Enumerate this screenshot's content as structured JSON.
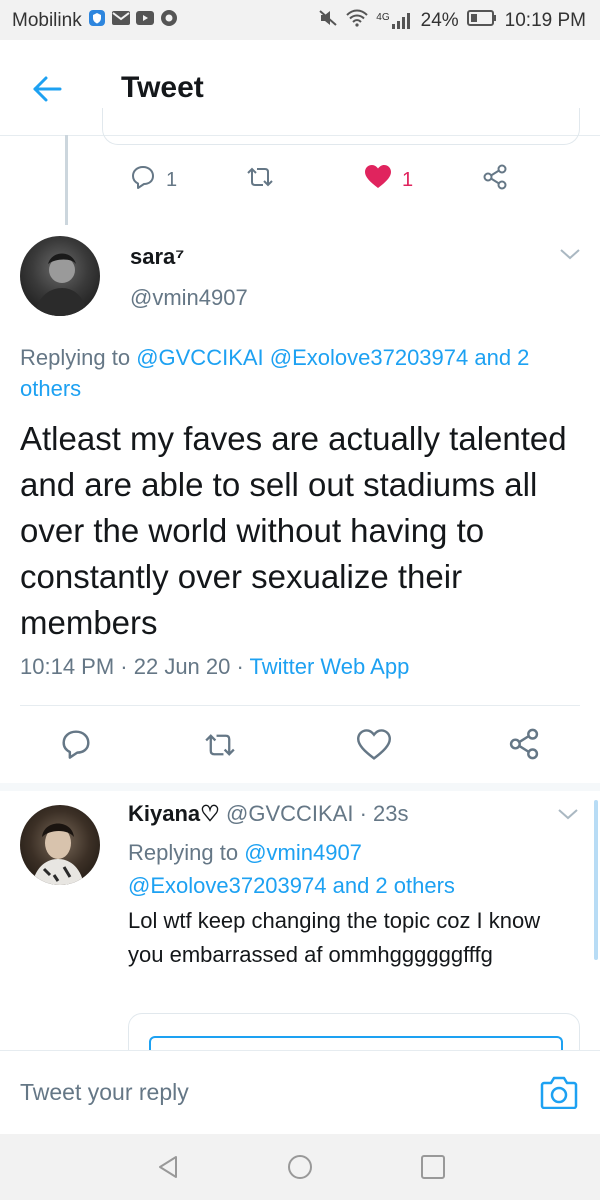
{
  "status_bar": {
    "carrier": "Mobilink",
    "network": "4G",
    "battery": "24%",
    "time": "10:19 PM"
  },
  "app_bar": {
    "title": "Tweet"
  },
  "parent_actions": {
    "reply_count": "1",
    "like_count": "1"
  },
  "main_tweet": {
    "name": "sara⁷",
    "handle": "@vmin4907",
    "replying_prefix": "Replying to ",
    "replying_links": "@GVCCIKAI @Exolove37203974 and 2 others",
    "text": "Atleast my faves are actually talented and are able to sell out stadiums all over the world without having to constantly over sexualize their members",
    "time": "10:14 PM",
    "sep1": " · ",
    "date": "22 Jun 20",
    "sep2": " · ",
    "source": "Twitter Web App"
  },
  "reply_tweet": {
    "name": "Kiyana♡",
    "handle": "@GVCCIKAI",
    "dot": " · ",
    "age": "23s",
    "replying_prefix": "Replying to ",
    "replying_links_1": "@vmin4907",
    "replying_links_2": "@Exolove37203974 and 2 others",
    "text": "Lol wtf keep changing the topic coz I know you embarrassed af ommhggggggfffg"
  },
  "composer": {
    "placeholder": "Tweet your reply"
  },
  "colors": {
    "accent": "#1da1f2",
    "like": "#e0245e",
    "muted": "#657786"
  },
  "icons": [
    "back-arrow-icon",
    "reply-icon",
    "retweet-icon",
    "heart-icon",
    "share-icon",
    "chevron-down-icon",
    "camera-icon",
    "nav-back-icon",
    "nav-home-icon",
    "nav-recents-icon"
  ]
}
